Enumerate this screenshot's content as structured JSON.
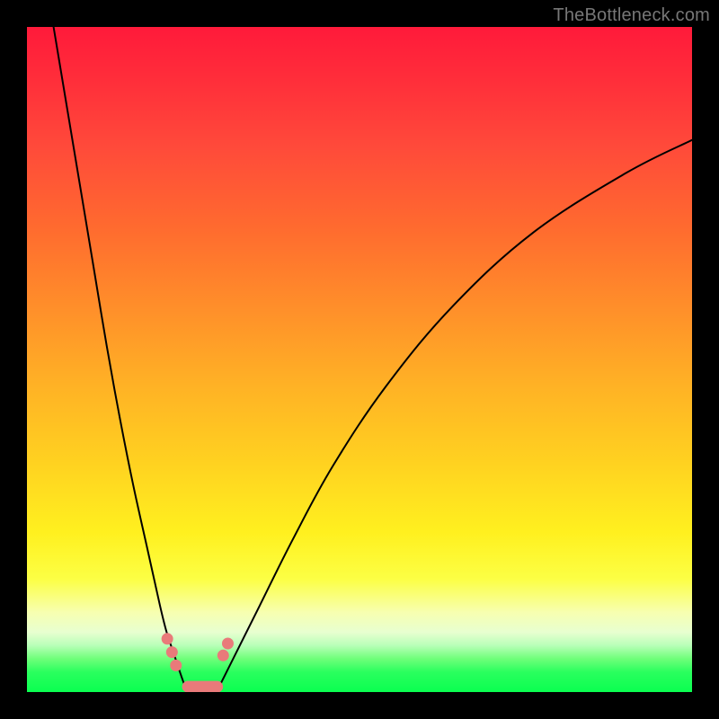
{
  "watermark": "TheBottleneck.com",
  "chart_data": {
    "type": "line",
    "title": "",
    "xlabel": "",
    "ylabel": "",
    "xlim": [
      0,
      100
    ],
    "ylim": [
      0,
      100
    ],
    "left_branch": {
      "x": [
        4,
        6,
        8,
        10,
        12,
        14,
        16,
        18,
        20,
        21,
        22,
        23,
        23.7
      ],
      "y": [
        100,
        88,
        76,
        64,
        52,
        41,
        31,
        22,
        13,
        9,
        6,
        3,
        1
      ]
    },
    "right_branch": {
      "x": [
        29,
        30,
        32,
        35,
        40,
        46,
        54,
        64,
        76,
        90,
        100
      ],
      "y": [
        1,
        3,
        7,
        13,
        23,
        34,
        46,
        58,
        69,
        78,
        83
      ]
    },
    "valley_floor": {
      "x_start": 23.7,
      "x_end": 29,
      "y": 0.5
    },
    "markers": [
      {
        "x": 21.1,
        "y": 8.0
      },
      {
        "x": 21.8,
        "y": 6.0
      },
      {
        "x": 22.4,
        "y": 4.0
      },
      {
        "x": 29.5,
        "y": 5.5
      },
      {
        "x": 30.2,
        "y": 7.3
      }
    ],
    "floor_pill": {
      "x_start": 24.2,
      "x_end": 28.6,
      "y": 0.8
    }
  }
}
